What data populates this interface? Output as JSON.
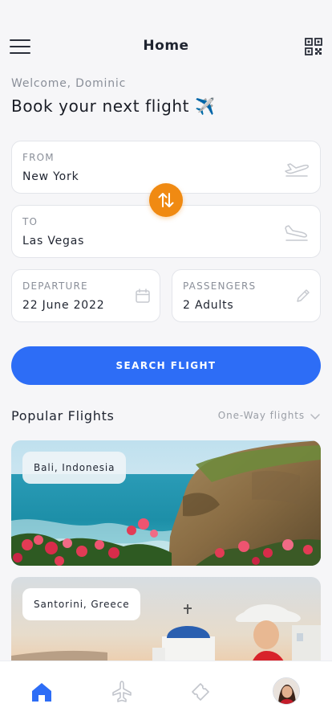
{
  "header": {
    "title": "Home",
    "menu_icon": "hamburger-menu-icon",
    "qr_icon": "qr-code-icon"
  },
  "greeting": {
    "welcome": "Welcome, Dominic",
    "headline": "Book your next flight ✈️"
  },
  "form": {
    "from": {
      "label": "FROM",
      "value": "New York",
      "icon": "takeoff-icon"
    },
    "to": {
      "label": "TO",
      "value": "Las Vegas",
      "icon": "landing-icon"
    },
    "departure": {
      "label": "DEPARTURE",
      "value": "22 June 2022",
      "icon": "calendar-icon"
    },
    "passengers": {
      "label": "PASSENGERS",
      "value": "2 Adults",
      "icon": "pencil-icon"
    },
    "swap_icon": "swap-arrows-icon",
    "search_label": "SEARCH FLIGHT"
  },
  "popular": {
    "title": "Popular Flights",
    "filter": "One-Way flights",
    "cards": [
      {
        "place": "Bali, Indonesia"
      },
      {
        "place": "Santorini, Greece"
      }
    ]
  },
  "tabbar": {
    "items": [
      "home-icon",
      "airplane-icon",
      "ticket-icon",
      "avatar"
    ]
  },
  "colors": {
    "accent": "#2d6df6",
    "swap": "#f08a12",
    "background": "#f6f6f8"
  }
}
